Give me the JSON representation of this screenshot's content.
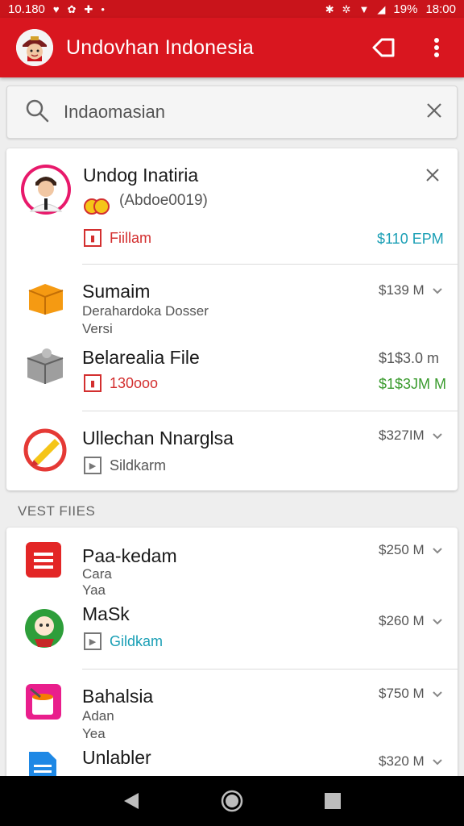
{
  "status_bar": {
    "time": "10.180",
    "battery": "19%",
    "clock_right": "18:00"
  },
  "app_bar": {
    "title": "Undovhan Indonesia",
    "actions": [
      "tag-icon",
      "more-vert-icon"
    ]
  },
  "search": {
    "value": "Indaomasian",
    "clear_icon": "close-icon",
    "icon": "search-icon"
  },
  "featured": {
    "title": "Undog Inatiria",
    "subtitle": "(Abdoe0019)",
    "tag": "Fiillam",
    "price": "$110 EPM",
    "close_icon": "close-icon"
  },
  "items1": [
    {
      "title": "Sumaim",
      "line1": "Derahardoka Dosser",
      "line2": "Versi",
      "price": "$139 M"
    },
    {
      "title": "Belarealia File",
      "tag": "130ooo",
      "price": "$1$3.0 m",
      "price2": "$1$3JM M"
    },
    {
      "title": "Ullechan Nnarglsa",
      "tag": "Sildkarm",
      "price": "$327IM"
    }
  ],
  "section_label": "VEST FIIES",
  "items2": [
    {
      "title": "Paa-kedam",
      "line1": "Cara",
      "line2": "Yaa"
    },
    {
      "title": "MaSk",
      "tag": "Gildkam"
    },
    {
      "title": "Bahalsia",
      "line1": "Adan",
      "line2": "Yea"
    },
    {
      "title": "Unlabler"
    }
  ],
  "items2_prices": [
    "$250 M",
    "$260 M",
    "$750 M",
    "$320 M"
  ],
  "colors": {
    "brand_red": "#d9161f",
    "status_red": "#c9141b",
    "price_teal": "#1a9fb5",
    "price_green": "#3a9b2e",
    "tag_red": "#d32f2f",
    "tag_blue": "#1a9fb5"
  }
}
